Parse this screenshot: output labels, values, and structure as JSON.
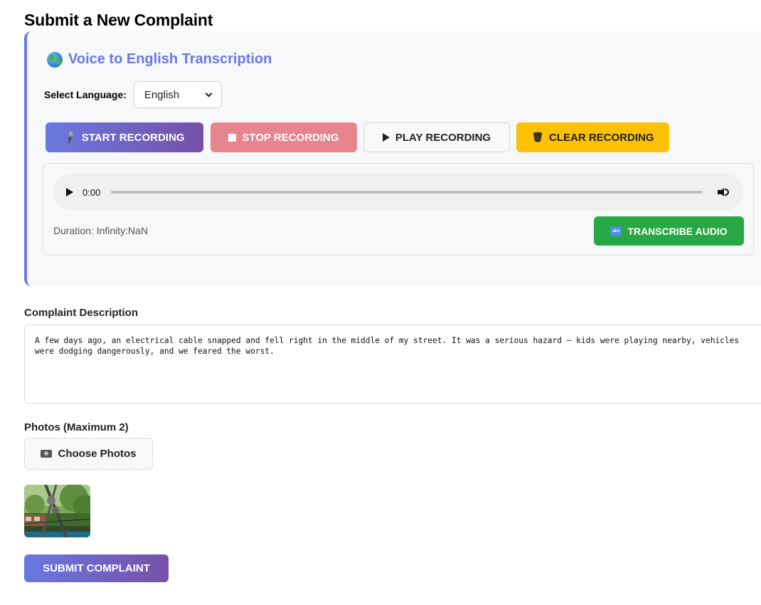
{
  "page": {
    "title": "Submit a New Complaint"
  },
  "voice": {
    "title": "Voice to English Transcription",
    "language_label": "Select Language:",
    "language_value": "English",
    "buttons": {
      "start": "START RECORDING",
      "stop": "STOP RECORDING",
      "play": "PLAY RECORDING",
      "clear": "CLEAR RECORDING"
    },
    "player": {
      "time": "0:00"
    },
    "duration": "Duration: Infinity:NaN",
    "transcribe": "TRANSCRIBE AUDIO"
  },
  "description": {
    "label": "Complaint Description",
    "value": "A few days ago, an electrical cable snapped and fell right in the middle of my street. It was a serious hazard — kids were playing nearby, vehicles were dodging dangerously, and we feared the worst."
  },
  "photos": {
    "label": "Photos (Maximum 2)",
    "choose": "Choose Photos"
  },
  "submit": "SUBMIT COMPLAINT",
  "colors": {
    "accent": "#6a78e0",
    "stop": "#e8848e",
    "clear": "#ffc107",
    "transcribe": "#28a745"
  }
}
